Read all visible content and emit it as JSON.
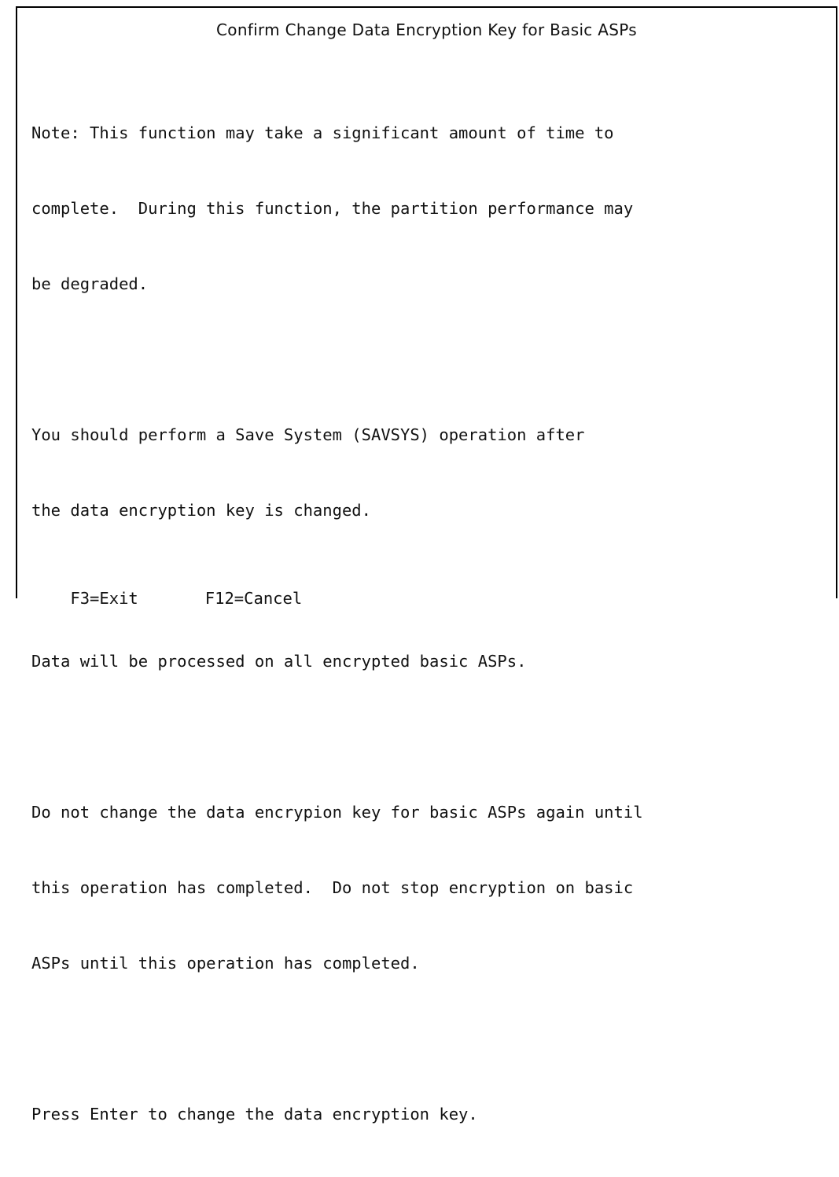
{
  "screen": {
    "title": "Confirm Change Data Encryption Key for Basic ASPs",
    "paragraphs": [
      {
        "lines": [
          "Note: This function may take a significant amount of time to",
          "complete.  During this function, the partition performance may",
          "be degraded."
        ]
      },
      {
        "lines": [
          "You should perform a Save System (SAVSYS) operation after",
          "the data encryption key is changed."
        ]
      },
      {
        "lines": [
          "Data will be processed on all encrypted basic ASPs."
        ]
      },
      {
        "lines": [
          "Do not change the data encrypion key for basic ASPs again until",
          "this operation has completed.  Do not stop encryption on basic",
          "ASPs until this operation has completed."
        ]
      },
      {
        "lines": [
          "Press Enter to change the data encryption key."
        ]
      }
    ],
    "function_keys": {
      "f3": "F3=Exit",
      "f12": "F12=Cancel"
    }
  }
}
